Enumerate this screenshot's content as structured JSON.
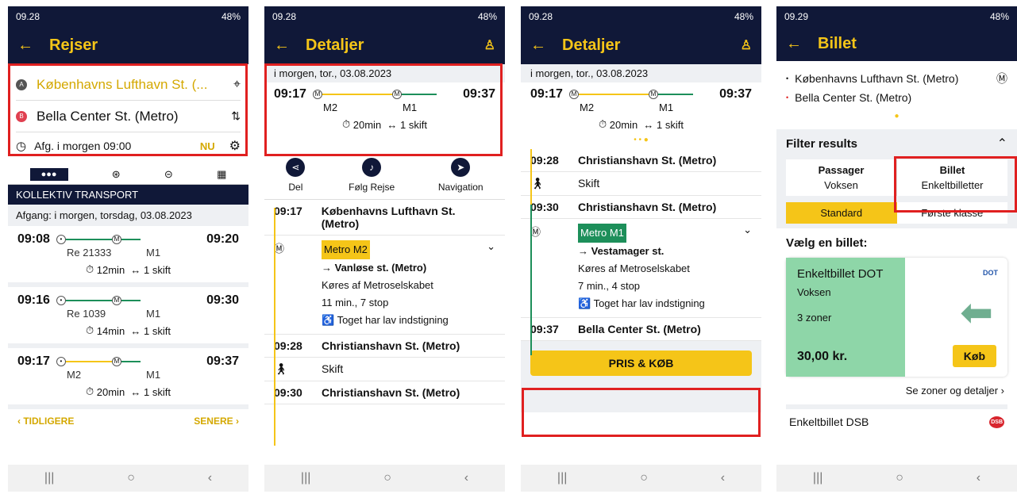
{
  "status": {
    "time1": "09.28",
    "time4": "09.29",
    "battery": "48%"
  },
  "s1": {
    "title": "Rejser",
    "from": "Københavns Lufthavn St. (...",
    "to": "Bella Center St. (Metro)",
    "depart": "Afg.  i morgen  09:00",
    "nu": "NU",
    "tab_label": "KOLLEKTIV TRANSPORT",
    "date_bar": "Afgang: i morgen, torsdag, 03.08.2023",
    "trips": [
      {
        "dep": "09:08",
        "arr": "09:20",
        "l1": "Re 21333",
        "l2": "M1",
        "dur": "12min",
        "chg": "1 skift"
      },
      {
        "dep": "09:16",
        "arr": "09:30",
        "l1": "Re 1039",
        "l2": "M1",
        "dur": "14min",
        "chg": "1 skift"
      },
      {
        "dep": "09:17",
        "arr": "09:37",
        "l1": "M2",
        "l2": "M1",
        "dur": "20min",
        "chg": "1 skift"
      }
    ],
    "earlier": "TIDLIGERE",
    "later": "SENERE"
  },
  "s2": {
    "title": "Detaljer",
    "date": "i morgen, tor., 03.08.2023",
    "dep": "09:17",
    "arr": "09:37",
    "l1": "M2",
    "l2": "M1",
    "dur": "20min",
    "chg": "1 skift",
    "act_share": "Del",
    "act_follow": "Følg Rejse",
    "act_nav": "Navigation",
    "stop1_time": "09:17",
    "stop1_name": "Københavns Lufthavn St. (Metro)",
    "metro": "Metro M2",
    "dir": "Vanløse st. (Metro)",
    "op": "Køres af Metroselskabet",
    "info": "11 min., 7 stop",
    "access": "Toget har lav indstigning",
    "stop2_time": "09:28",
    "stop2_name": "Christianshavn St. (Metro)",
    "skift": "Skift",
    "stop3_time": "09:30",
    "stop3_name": "Christianshavn St. (Metro)"
  },
  "s3": {
    "title": "Detaljer",
    "date": "i morgen, tor., 03.08.2023",
    "dep": "09:17",
    "arr": "09:37",
    "l1": "M2",
    "l2": "M1",
    "dur": "20min",
    "chg": "1 skift",
    "stop1_time": "09:28",
    "stop1_name": "Christianshavn St. (Metro)",
    "skift": "Skift",
    "stop2_time": "09:30",
    "stop2_name": "Christianshavn St. (Metro)",
    "metro": "Metro M1",
    "dir": "Vestamager st.",
    "op": "Køres af Metroselskabet",
    "info": "7 min., 4 stop",
    "access": "Toget har lav indstigning",
    "stop3_time": "09:37",
    "stop3_name": "Bella Center St. (Metro)",
    "buy_btn": "PRIS & KØB"
  },
  "s4": {
    "title": "Billet",
    "from": "Københavns Lufthavn St. (Metro)",
    "to": "Bella Center St. (Metro)",
    "filter": "Filter results",
    "pass_label": "Passager",
    "pass_val": "Voksen",
    "ticket_label": "Billet",
    "ticket_val": "Enkeltbilletter",
    "seg1": "Standard",
    "seg2": "Første klasse",
    "choose": "Vælg en billet:",
    "card_title": "Enkeltbillet DOT",
    "card_sub": "Voksen",
    "zones": "3 zoner",
    "dot_logo": "DOT",
    "price": "30,00 kr.",
    "buy": "Køb",
    "see_zones": "Se zoner og detaljer",
    "dsb_title": "Enkeltbillet DSB",
    "dsb_logo": "DSB"
  }
}
